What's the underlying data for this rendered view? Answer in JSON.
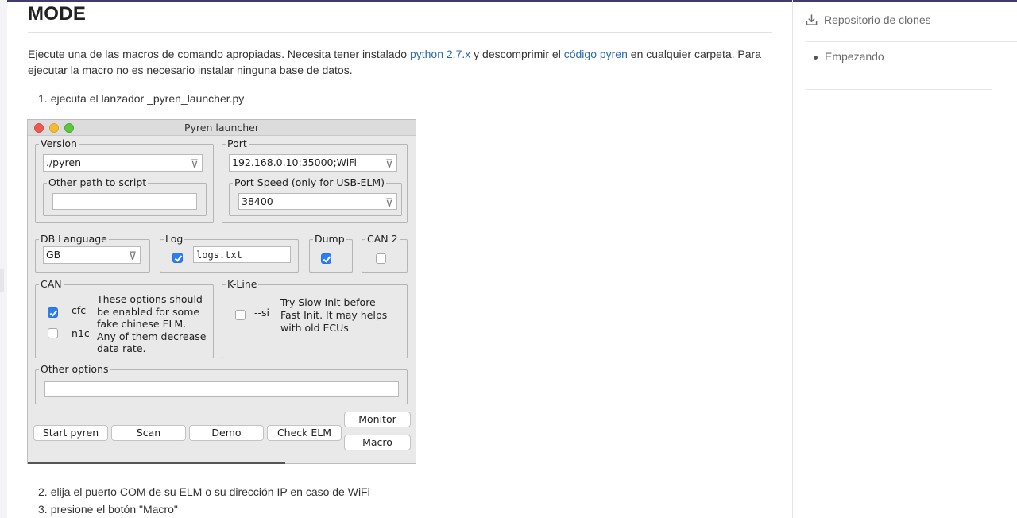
{
  "heading": "MODE",
  "intro": {
    "text_1": "Ejecute una de las macros de comando apropiadas. Necesita tener instalado ",
    "link_python": "python 2.7.x",
    "text_2": " y descomprimir el ",
    "link_code": "código pyren",
    "text_3": " en cualquier carpeta. Para ejecutar la macro no es necesario instalar ninguna base de datos."
  },
  "steps": [
    {
      "num": "1.",
      "text": "ejecuta el lanzador _pyren_launcher.py"
    },
    {
      "num": "2.",
      "text": "elija el puerto COM de su ELM o su dirección IP en caso de WiFi"
    },
    {
      "num": "3.",
      "text": "presione el botón \"Macro\""
    }
  ],
  "sidebar": {
    "repo_label": "Repositorio de clones",
    "toc": [
      "Empezando"
    ]
  },
  "launcher": {
    "title": "Pyren launcher",
    "version": {
      "label": "Version",
      "value": "./pyren"
    },
    "other_path": {
      "label": "Other path to script",
      "value": ""
    },
    "port": {
      "label": "Port",
      "value": "192.168.0.10:35000;WiFi"
    },
    "port_speed": {
      "label": "Port Speed (only for USB-ELM)",
      "value": "38400"
    },
    "db_language": {
      "label": "DB Language",
      "value": "GB"
    },
    "log": {
      "label": "Log",
      "checked": true,
      "value": "logs.txt"
    },
    "dump": {
      "label": "Dump",
      "checked": true
    },
    "can2": {
      "label": "CAN 2",
      "checked": false
    },
    "can": {
      "label": "CAN",
      "cfc": {
        "label": "--cfc",
        "checked": true
      },
      "n1c": {
        "label": "--n1c",
        "checked": false
      },
      "note": [
        "These options should",
        "be enabled for some",
        "fake chinese ELM.",
        "Any of them decrease",
        "data rate."
      ]
    },
    "kline": {
      "label": "K-Line",
      "si": {
        "label": "--si",
        "checked": false
      },
      "note": [
        "Try Slow Init before",
        "Fast Init. It may helps",
        "with old ECUs"
      ]
    },
    "other_options": {
      "label": "Other options",
      "value": ""
    },
    "buttons": {
      "start": "Start pyren",
      "scan": "Scan",
      "demo": "Demo",
      "check": "Check ELM",
      "monitor": "Monitor",
      "macro": "Macro"
    }
  }
}
